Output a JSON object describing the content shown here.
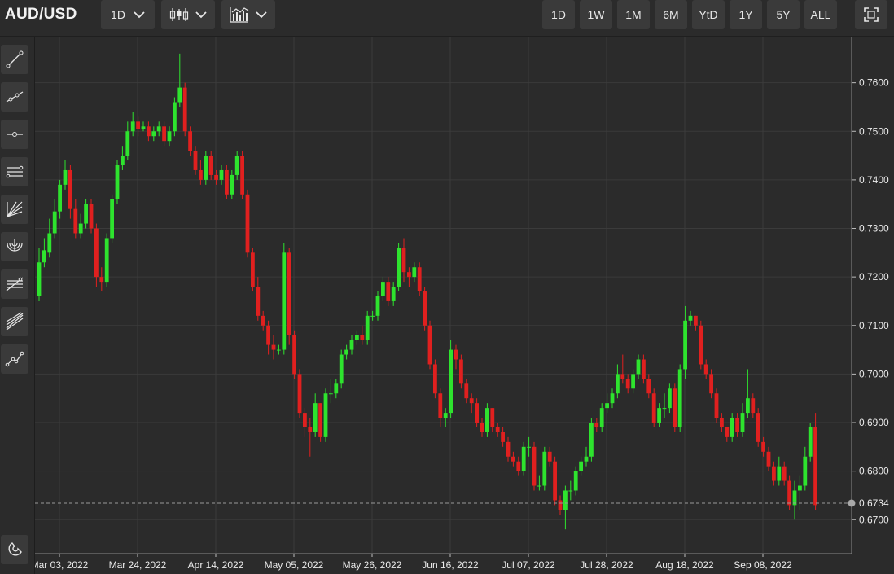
{
  "header": {
    "symbol": "AUD/USD",
    "interval_label": "1D",
    "chart_style_icon": "candlestick-icon",
    "indicators_icon": "indicators-icon",
    "ranges": [
      "1D",
      "1W",
      "1M",
      "6M",
      "YtD",
      "1Y",
      "5Y",
      "ALL"
    ],
    "fullscreen_icon": "fullscreen-icon"
  },
  "sidebar": {
    "tools": [
      "trend-line-icon",
      "ray-line-icon",
      "horizontal-line-icon",
      "parallel-channel-icon",
      "pitchfork-icon",
      "fib-arc-icon",
      "fib-retracement-icon",
      "fib-fan-icon",
      "polyline-icon"
    ],
    "magnet_icon": "magnet-icon"
  },
  "colors": {
    "background": "#2b2b2b",
    "grid": "#3b3b3b",
    "up": "#2ee32e",
    "down": "#e0201f",
    "last_price_line": "#9a9a9a"
  },
  "chart_data": {
    "type": "candlestick",
    "title": "AUD/USD",
    "ylim": [
      0.663,
      0.7695
    ],
    "y_ticks": [
      "0.6700",
      "0.6800",
      "0.6900",
      "0.7000",
      "0.7100",
      "0.7200",
      "0.7300",
      "0.7400",
      "0.7500",
      "0.7600"
    ],
    "x_ticks": [
      "Mar 03, 2022",
      "Mar 24, 2022",
      "Apr 14, 2022",
      "May 05, 2022",
      "May 26, 2022",
      "Jun 16, 2022",
      "Jul 07, 2022",
      "Jul 28, 2022",
      "Aug 18, 2022",
      "Sep 08, 2022"
    ],
    "last_price": 0.6734,
    "last_price_label": "0.6734",
    "grid": true,
    "close": [
      0.723,
      0.7255,
      0.729,
      0.7335,
      0.739,
      0.742,
      0.734,
      0.729,
      0.731,
      0.735,
      0.73,
      0.72,
      0.719,
      0.728,
      0.736,
      0.743,
      0.745,
      0.75,
      0.752,
      0.7505,
      0.751,
      0.749,
      0.75,
      0.751,
      0.748,
      0.75,
      0.756,
      0.759,
      0.75,
      0.746,
      0.742,
      0.74,
      0.745,
      0.741,
      0.74,
      0.742,
      0.737,
      0.741,
      0.745,
      0.737,
      0.725,
      0.718,
      0.712,
      0.71,
      0.706,
      0.705,
      0.705,
      0.725,
      0.708,
      0.7,
      0.692,
      0.689,
      0.688,
      0.694,
      0.687,
      0.696,
      0.696,
      0.698,
      0.704,
      0.705,
      0.707,
      0.708,
      0.707,
      0.712,
      0.712,
      0.716,
      0.719,
      0.715,
      0.718,
      0.726,
      0.721,
      0.72,
      0.722,
      0.717,
      0.71,
      0.702,
      0.696,
      0.691,
      0.692,
      0.705,
      0.703,
      0.698,
      0.695,
      0.694,
      0.69,
      0.688,
      0.693,
      0.689,
      0.688,
      0.686,
      0.683,
      0.682,
      0.68,
      0.685,
      0.685,
      0.677,
      0.677,
      0.684,
      0.682,
      0.674,
      0.672,
      0.676,
      0.676,
      0.68,
      0.682,
      0.683,
      0.69,
      0.689,
      0.693,
      0.694,
      0.696,
      0.7,
      0.699,
      0.697,
      0.7,
      0.703,
      0.699,
      0.696,
      0.69,
      0.693,
      0.693,
      0.697,
      0.689,
      0.701,
      0.711,
      0.712,
      0.71,
      0.702,
      0.7,
      0.696,
      0.691,
      0.689,
      0.687,
      0.691,
      0.688,
      0.692,
      0.695,
      0.692,
      0.686,
      0.684,
      0.681,
      0.678,
      0.681,
      0.678,
      0.673,
      0.676,
      0.677,
      0.683,
      0.689,
      0.673
    ],
    "open": [
      0.716,
      0.723,
      0.725,
      0.729,
      0.7335,
      0.739,
      0.742,
      0.734,
      0.729,
      0.731,
      0.735,
      0.73,
      0.72,
      0.719,
      0.728,
      0.736,
      0.743,
      0.745,
      0.75,
      0.752,
      0.7505,
      0.751,
      0.749,
      0.75,
      0.751,
      0.748,
      0.75,
      0.756,
      0.759,
      0.75,
      0.746,
      0.742,
      0.74,
      0.745,
      0.741,
      0.74,
      0.742,
      0.737,
      0.741,
      0.745,
      0.737,
      0.725,
      0.718,
      0.712,
      0.71,
      0.706,
      0.705,
      0.705,
      0.725,
      0.708,
      0.7,
      0.692,
      0.689,
      0.688,
      0.694,
      0.687,
      0.696,
      0.696,
      0.698,
      0.704,
      0.705,
      0.707,
      0.708,
      0.707,
      0.712,
      0.712,
      0.716,
      0.719,
      0.715,
      0.718,
      0.726,
      0.721,
      0.72,
      0.722,
      0.717,
      0.71,
      0.702,
      0.696,
      0.691,
      0.692,
      0.705,
      0.703,
      0.698,
      0.695,
      0.694,
      0.69,
      0.688,
      0.693,
      0.689,
      0.688,
      0.686,
      0.683,
      0.682,
      0.68,
      0.685,
      0.685,
      0.677,
      0.677,
      0.684,
      0.682,
      0.674,
      0.672,
      0.676,
      0.676,
      0.68,
      0.682,
      0.683,
      0.69,
      0.689,
      0.693,
      0.694,
      0.696,
      0.7,
      0.699,
      0.697,
      0.7,
      0.703,
      0.699,
      0.696,
      0.69,
      0.693,
      0.693,
      0.697,
      0.689,
      0.701,
      0.711,
      0.712,
      0.71,
      0.702,
      0.7,
      0.696,
      0.691,
      0.689,
      0.687,
      0.691,
      0.688,
      0.692,
      0.695,
      0.692,
      0.686,
      0.684,
      0.681,
      0.678,
      0.681,
      0.678,
      0.673,
      0.676,
      0.677,
      0.683,
      0.689
    ],
    "high": [
      0.726,
      0.728,
      0.732,
      0.736,
      0.74,
      0.744,
      0.743,
      0.736,
      0.733,
      0.736,
      0.736,
      0.731,
      0.722,
      0.729,
      0.737,
      0.744,
      0.747,
      0.752,
      0.754,
      0.753,
      0.752,
      0.752,
      0.751,
      0.752,
      0.752,
      0.751,
      0.757,
      0.766,
      0.76,
      0.751,
      0.747,
      0.744,
      0.746,
      0.746,
      0.742,
      0.743,
      0.743,
      0.742,
      0.746,
      0.746,
      0.738,
      0.726,
      0.72,
      0.713,
      0.711,
      0.708,
      0.706,
      0.727,
      0.726,
      0.709,
      0.701,
      0.693,
      0.691,
      0.696,
      0.694,
      0.697,
      0.699,
      0.699,
      0.705,
      0.706,
      0.708,
      0.709,
      0.71,
      0.713,
      0.713,
      0.717,
      0.72,
      0.72,
      0.719,
      0.727,
      0.728,
      0.722,
      0.723,
      0.723,
      0.718,
      0.711,
      0.703,
      0.697,
      0.693,
      0.707,
      0.706,
      0.704,
      0.699,
      0.696,
      0.695,
      0.691,
      0.694,
      0.693,
      0.69,
      0.689,
      0.687,
      0.684,
      0.683,
      0.686,
      0.687,
      0.686,
      0.679,
      0.685,
      0.685,
      0.683,
      0.675,
      0.677,
      0.678,
      0.681,
      0.683,
      0.685,
      0.691,
      0.691,
      0.694,
      0.696,
      0.697,
      0.702,
      0.704,
      0.7,
      0.701,
      0.704,
      0.704,
      0.7,
      0.697,
      0.694,
      0.696,
      0.698,
      0.698,
      0.702,
      0.714,
      0.713,
      0.712,
      0.711,
      0.703,
      0.701,
      0.697,
      0.692,
      0.689,
      0.692,
      0.692,
      0.694,
      0.701,
      0.696,
      0.693,
      0.687,
      0.685,
      0.682,
      0.683,
      0.682,
      0.679,
      0.678,
      0.679,
      0.685,
      0.69,
      0.692
    ],
    "low": [
      0.715,
      0.722,
      0.724,
      0.728,
      0.732,
      0.738,
      0.732,
      0.728,
      0.728,
      0.73,
      0.729,
      0.718,
      0.717,
      0.718,
      0.727,
      0.735,
      0.742,
      0.744,
      0.749,
      0.749,
      0.75,
      0.748,
      0.748,
      0.749,
      0.747,
      0.747,
      0.749,
      0.755,
      0.749,
      0.745,
      0.741,
      0.739,
      0.739,
      0.74,
      0.739,
      0.739,
      0.736,
      0.736,
      0.74,
      0.736,
      0.724,
      0.717,
      0.711,
      0.709,
      0.704,
      0.703,
      0.704,
      0.704,
      0.706,
      0.699,
      0.691,
      0.687,
      0.683,
      0.687,
      0.686,
      0.686,
      0.694,
      0.695,
      0.697,
      0.703,
      0.704,
      0.706,
      0.706,
      0.706,
      0.711,
      0.711,
      0.715,
      0.714,
      0.714,
      0.717,
      0.719,
      0.718,
      0.719,
      0.716,
      0.709,
      0.701,
      0.695,
      0.689,
      0.689,
      0.691,
      0.701,
      0.697,
      0.694,
      0.692,
      0.689,
      0.687,
      0.687,
      0.688,
      0.687,
      0.685,
      0.682,
      0.681,
      0.679,
      0.679,
      0.683,
      0.676,
      0.676,
      0.676,
      0.681,
      0.673,
      0.671,
      0.668,
      0.674,
      0.675,
      0.679,
      0.681,
      0.682,
      0.688,
      0.688,
      0.692,
      0.693,
      0.695,
      0.698,
      0.696,
      0.696,
      0.699,
      0.698,
      0.695,
      0.689,
      0.689,
      0.691,
      0.692,
      0.688,
      0.688,
      0.699,
      0.71,
      0.709,
      0.701,
      0.699,
      0.695,
      0.69,
      0.688,
      0.686,
      0.686,
      0.687,
      0.687,
      0.691,
      0.691,
      0.685,
      0.683,
      0.68,
      0.677,
      0.677,
      0.677,
      0.672,
      0.67,
      0.672,
      0.676,
      0.682,
      0.672
    ]
  }
}
